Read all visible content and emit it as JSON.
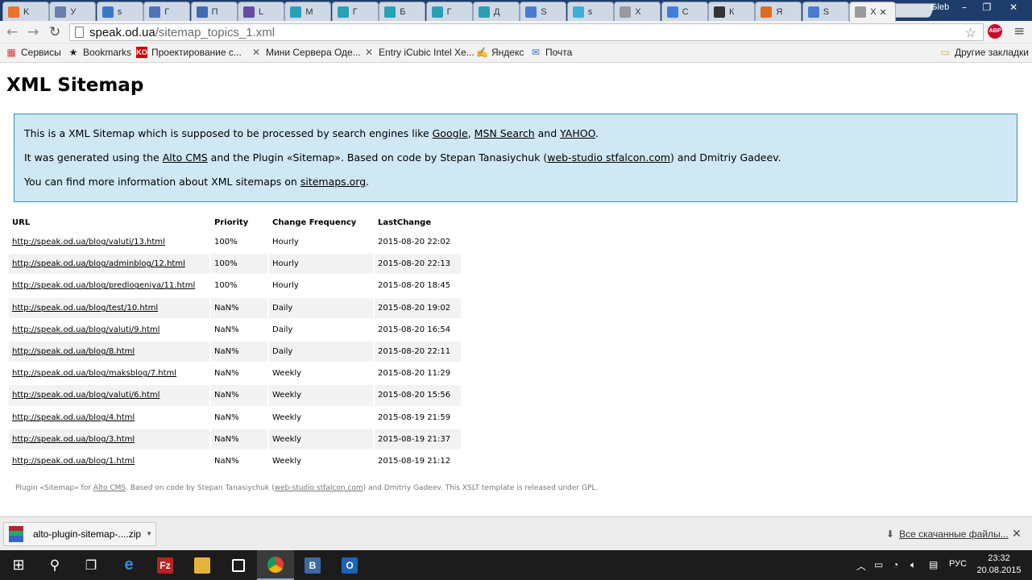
{
  "browser": {
    "tabs": [
      {
        "label": "K",
        "color": "#e8742d"
      },
      {
        "label": "У",
        "color": "#6a7fae"
      },
      {
        "label": "s",
        "color": "#3a77c9"
      },
      {
        "label": "Г",
        "color": "#4d72b8"
      },
      {
        "label": "П",
        "color": "#3f6ab0"
      },
      {
        "label": "L",
        "color": "#6b4aa3"
      },
      {
        "label": "М",
        "color": "#2aa0b6"
      },
      {
        "label": "Г",
        "color": "#2aa0b6"
      },
      {
        "label": "Б",
        "color": "#2aa0b6"
      },
      {
        "label": "Г",
        "color": "#2aa0b6"
      },
      {
        "label": "Д",
        "color": "#2aa0b6"
      },
      {
        "label": "S",
        "color": "#4a7bd0"
      },
      {
        "label": "s",
        "color": "#3ab0d6"
      },
      {
        "label": "Х",
        "color": "#9a9a9a"
      },
      {
        "label": "С",
        "color": "#3f7de0"
      },
      {
        "label": "К",
        "color": "#333333"
      },
      {
        "label": "Я",
        "color": "#e06a1e"
      },
      {
        "label": "S",
        "color": "#4a7bd0"
      },
      {
        "label": "Х",
        "color": "#9a9a9a"
      }
    ],
    "user": "Gleb",
    "url_host": "speak.od.ua",
    "url_path": "/sitemap_topics_1.xml",
    "abp": "ABP",
    "bookmarks": [
      {
        "label": "Сервисы",
        "icon": "apps-icon"
      },
      {
        "label": "Bookmarks",
        "icon": "star-icon"
      },
      {
        "label": "Проектирование с...",
        "icon": "ko-icon"
      },
      {
        "label": "Мини Сервера Оде...",
        "icon": "tools-icon"
      },
      {
        "label": "Entry iCubic Intel Xe...",
        "icon": "tools-icon"
      },
      {
        "label": "Яндекс",
        "icon": "yandex-icon"
      },
      {
        "label": "Почта",
        "icon": "mail-icon"
      }
    ],
    "other_bookmarks": "Другие закладки"
  },
  "page": {
    "title": "XML Sitemap",
    "intro": {
      "p1_before": "This is a XML Sitemap which is supposed to be processed by search engines like ",
      "p1_link1": "Google",
      "p1_sep1": ", ",
      "p1_link2": "MSN Search",
      "p1_sep2": " and ",
      "p1_link3": "YAHOO",
      "p1_after": ".",
      "p2_before": "It was generated using the ",
      "p2_link1": "Alto CMS",
      "p2_mid": " and the Plugin «Sitemap». Based on code by Stepan Tanasiychuk (",
      "p2_link2": "web-studio stfalcon.com",
      "p2_after": ") and Dmitriy Gadeev.",
      "p3_before": "You can find more information about XML sitemaps on ",
      "p3_link": "sitemaps.org",
      "p3_after": "."
    },
    "table": {
      "headers": [
        "URL",
        "Priority",
        "Change Frequency",
        "LastChange"
      ],
      "rows": [
        [
          "http://speak.od.ua/blog/valuti/13.html",
          "100%",
          "Hourly",
          "2015-08-20 22:02"
        ],
        [
          "http://speak.od.ua/blog/adminblog/12.html",
          "100%",
          "Hourly",
          "2015-08-20 22:13"
        ],
        [
          "http://speak.od.ua/blog/predlogeniya/11.html",
          "100%",
          "Hourly",
          "2015-08-20 18:45"
        ],
        [
          "http://speak.od.ua/blog/test/10.html",
          "NaN%",
          "Daily",
          "2015-08-20 19:02"
        ],
        [
          "http://speak.od.ua/blog/valuti/9.html",
          "NaN%",
          "Daily",
          "2015-08-20 16:54"
        ],
        [
          "http://speak.od.ua/blog/8.html",
          "NaN%",
          "Daily",
          "2015-08-20 22:11"
        ],
        [
          "http://speak.od.ua/blog/maksblog/7.html",
          "NaN%",
          "Weekly",
          "2015-08-20 11:29"
        ],
        [
          "http://speak.od.ua/blog/valuti/6.html",
          "NaN%",
          "Weekly",
          "2015-08-20 15:56"
        ],
        [
          "http://speak.od.ua/blog/4.html",
          "NaN%",
          "Weekly",
          "2015-08-19 21:59"
        ],
        [
          "http://speak.od.ua/blog/3.html",
          "NaN%",
          "Weekly",
          "2015-08-19 21:37"
        ],
        [
          "http://speak.od.ua/blog/1.html",
          "NaN%",
          "Weekly",
          "2015-08-19 21:12"
        ]
      ]
    },
    "footer": {
      "before": "Plugin «Sitemap» for ",
      "link1": "Alto CMS",
      "mid": ". Based on code by Stepan Tanasiychuk (",
      "link2": "web-studio stfalcon.com",
      "after": ") and Dmitriy Gadeev. This XSLT template is released under GPL."
    }
  },
  "downloads": {
    "file": "alto-plugin-sitemap-....zip",
    "all_files": "Все скачанные файлы..."
  },
  "taskbar": {
    "lang": "РУС",
    "time": "23:32",
    "date": "20.08.2015",
    "apps": [
      "start",
      "search",
      "task-view",
      "edge",
      "filezilla",
      "explorer",
      "store",
      "chrome",
      "vk",
      "outlook"
    ]
  }
}
